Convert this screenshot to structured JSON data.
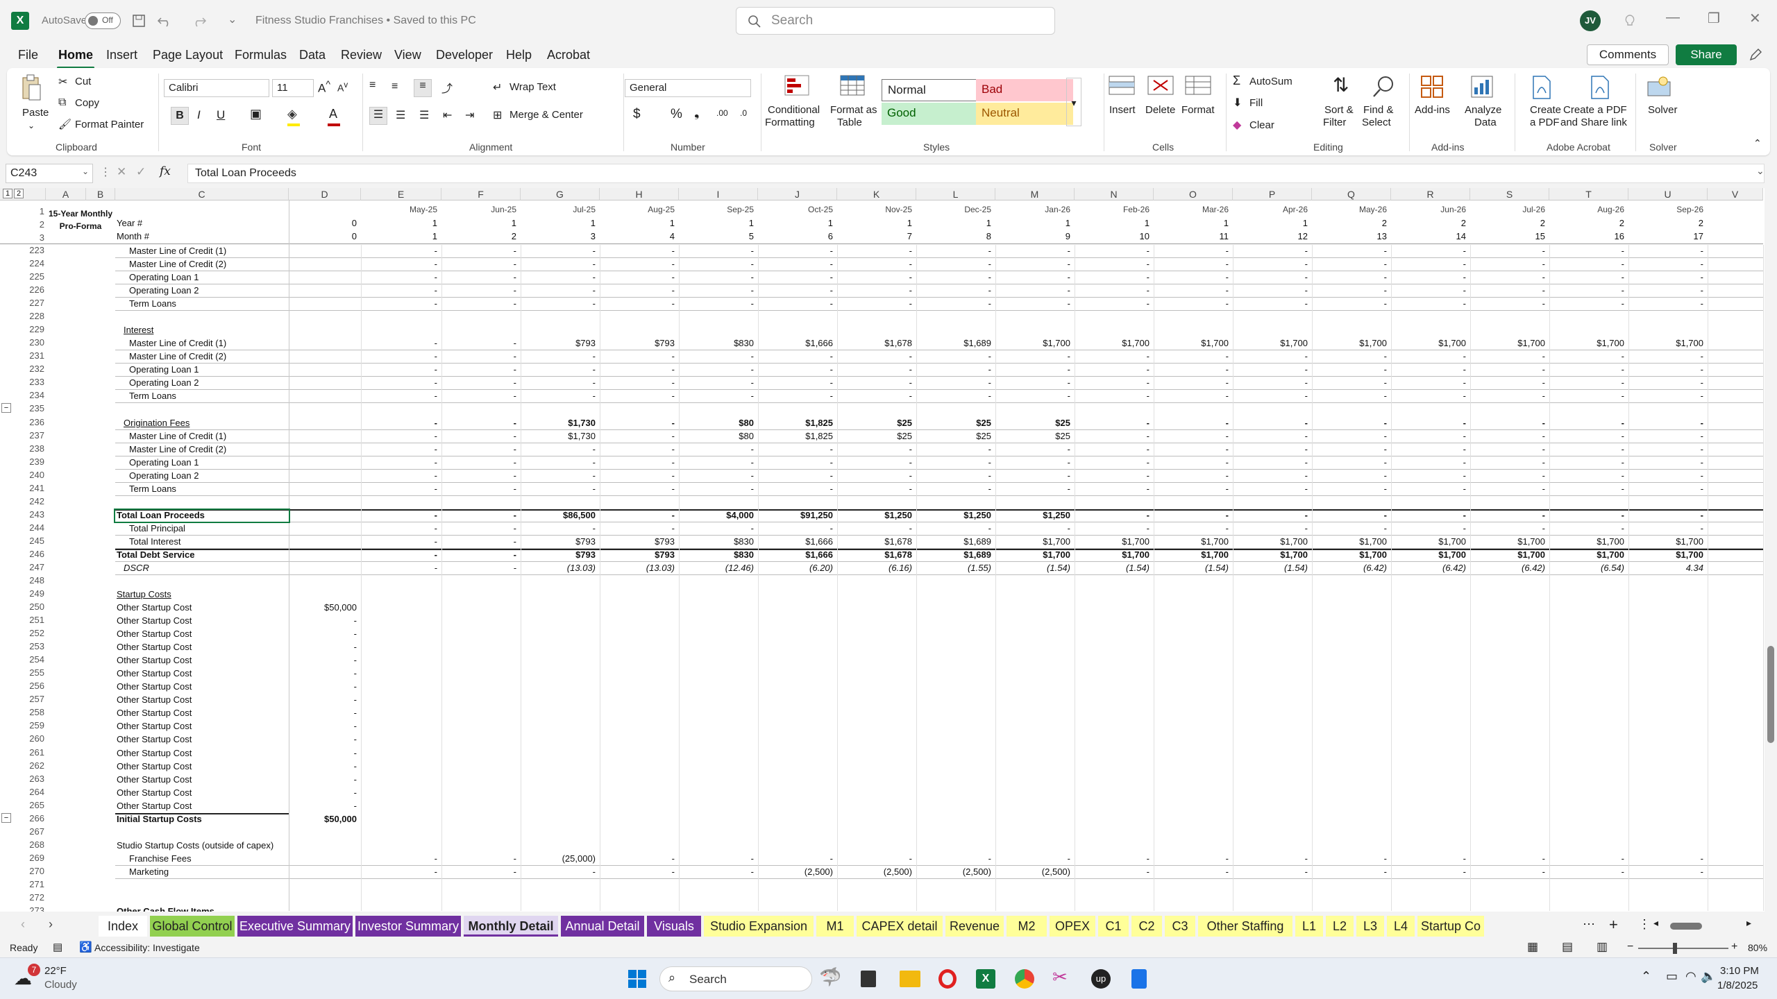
{
  "app": {
    "autosave_label": "AutoSave",
    "autosave_state": "Off",
    "doc_title": "Fitness Studio Franchises • Saved to this PC",
    "search_placeholder": "Search",
    "user_initials": "JV"
  },
  "menu": [
    "File",
    "Home",
    "Insert",
    "Page Layout",
    "Formulas",
    "Data",
    "Review",
    "View",
    "Developer",
    "Help",
    "Acrobat"
  ],
  "buttons": {
    "comments": "Comments",
    "share": "Share"
  },
  "ribbon": {
    "clipboard": {
      "paste": "Paste",
      "cut": "Cut",
      "copy": "Copy",
      "format_painter": "Format Painter",
      "label": "Clipboard"
    },
    "font": {
      "name": "Calibri",
      "size": "11",
      "label": "Font"
    },
    "alignment": {
      "wrap": "Wrap Text",
      "merge": "Merge & Center",
      "label": "Alignment"
    },
    "number": {
      "format": "General",
      "label": "Number"
    },
    "styles": {
      "cond": "Conditional",
      "cond2": "Formatting",
      "fmt_table": "Format as",
      "fmt_table2": "Table",
      "normal": "Normal",
      "bad": "Bad",
      "good": "Good",
      "neutral": "Neutral",
      "label": "Styles"
    },
    "cells": {
      "insert": "Insert",
      "delete": "Delete",
      "format": "Format",
      "label": "Cells"
    },
    "editing": {
      "autosum": "AutoSum",
      "fill": "Fill",
      "clear": "Clear",
      "sort": "Sort &",
      "sort2": "Filter",
      "find": "Find &",
      "find2": "Select",
      "label": "Editing"
    },
    "addins": {
      "addins": "Add-ins",
      "analyze": "Analyze",
      "analyze2": "Data",
      "label": "Add-ins"
    },
    "acrobat": {
      "create_pdf": "Create",
      "create_pdf2": "a PDF",
      "share_link": "Create a PDF",
      "share_link2": "and Share link",
      "label": "Adobe Acrobat"
    },
    "solver": {
      "solver": "Solver",
      "label": "Solver"
    },
    "colors": {
      "bad_bg": "#ffc7ce",
      "bad_fg": "#9c0006",
      "good_bg": "#c6efce",
      "good_fg": "#006100",
      "neutral_bg": "#ffeb9c",
      "neutral_fg": "#9c5700"
    }
  },
  "formula_bar": {
    "name_box": "C243",
    "formula": "Total Loan Proceeds"
  },
  "columns": [
    "A",
    "B",
    "C",
    "D",
    "E",
    "F",
    "G",
    "H",
    "I",
    "J",
    "K",
    "L",
    "M",
    "N",
    "O",
    "P",
    "Q",
    "R",
    "S",
    "T",
    "U",
    "V"
  ],
  "outline_levels": [
    "1",
    "2"
  ],
  "frozen": {
    "title": [
      "15-Year Monthly",
      "Pro-Forma"
    ],
    "year_label": "Year #",
    "month_label": "Month #",
    "dates": [
      "May-25",
      "Jun-25",
      "Jul-25",
      "Aug-25",
      "Sep-25",
      "Oct-25",
      "Nov-25",
      "Dec-25",
      "Jan-26",
      "Feb-26",
      "Mar-26",
      "Apr-26",
      "May-26",
      "Jun-26",
      "Jul-26",
      "Aug-26",
      "Sep-26"
    ],
    "years": [
      "0",
      "1",
      "1",
      "1",
      "1",
      "1",
      "1",
      "1",
      "1",
      "1",
      "1",
      "1",
      "1",
      "2",
      "2",
      "2",
      "2",
      "2"
    ],
    "months": [
      "0",
      "1",
      "2",
      "3",
      "4",
      "5",
      "6",
      "7",
      "8",
      "9",
      "10",
      "11",
      "12",
      "13",
      "14",
      "15",
      "16",
      "17"
    ]
  },
  "rows": [
    {
      "n": "223",
      "label": "Master Line of Credit (1)",
      "indent": 1,
      "vals": "dash"
    },
    {
      "n": "224",
      "label": "Master Line of Credit (2)",
      "indent": 1,
      "vals": "dash"
    },
    {
      "n": "225",
      "label": "Operating Loan 1",
      "indent": 1,
      "vals": "dash"
    },
    {
      "n": "226",
      "label": "Operating Loan 2",
      "indent": 1,
      "vals": "dash"
    },
    {
      "n": "227",
      "label": "Term Loans",
      "indent": 1,
      "vals": "dash"
    },
    {
      "n": "228",
      "label": ""
    },
    {
      "n": "229",
      "label": "Interest",
      "indent": 2,
      "underline": true
    },
    {
      "n": "230",
      "label": "Master Line of Credit (1)",
      "indent": 1,
      "vals": [
        "-",
        "-",
        "$793",
        "$793",
        "$830",
        "$1,666",
        "$1,678",
        "$1,689",
        "$1,700",
        "$1,700",
        "$1,700",
        "$1,700",
        "$1,700",
        "$1,700",
        "$1,700",
        "$1,700",
        "$1,700"
      ]
    },
    {
      "n": "231",
      "label": "Master Line of Credit (2)",
      "indent": 1,
      "vals": "dash"
    },
    {
      "n": "232",
      "label": "Operating Loan 1",
      "indent": 1,
      "vals": "dash"
    },
    {
      "n": "233",
      "label": "Operating Loan 2",
      "indent": 1,
      "vals": "dash"
    },
    {
      "n": "234",
      "label": "Term Loans",
      "indent": 1,
      "vals": "dash"
    },
    {
      "n": "235",
      "label": ""
    },
    {
      "n": "236",
      "label": "Origination Fees",
      "indent": 2,
      "underline": true,
      "bold_vals": true,
      "vals": [
        "-",
        "-",
        "$1,730",
        "-",
        "$80",
        "$1,825",
        "$25",
        "$25",
        "$25",
        "-",
        "-",
        "-",
        "-",
        "-",
        "-",
        "-",
        "-"
      ]
    },
    {
      "n": "237",
      "label": "Master Line of Credit (1)",
      "indent": 1,
      "vals": [
        "-",
        "-",
        "$1,730",
        "-",
        "$80",
        "$1,825",
        "$25",
        "$25",
        "$25",
        "-",
        "-",
        "-",
        "-",
        "-",
        "-",
        "-",
        "-"
      ]
    },
    {
      "n": "238",
      "label": "Master Line of Credit (2)",
      "indent": 1,
      "vals": "dash"
    },
    {
      "n": "239",
      "label": "Operating Loan 1",
      "indent": 1,
      "vals": "dash"
    },
    {
      "n": "240",
      "label": "Operating Loan 2",
      "indent": 1,
      "vals": "dash"
    },
    {
      "n": "241",
      "label": "Term Loans",
      "indent": 1,
      "vals": "dash"
    },
    {
      "n": "242",
      "label": ""
    },
    {
      "n": "243",
      "label": "Total Loan Proceeds",
      "bold": true,
      "bold_vals": true,
      "vals": [
        "-",
        "-",
        "$86,500",
        "-",
        "$4,000",
        "$91,250",
        "$1,250",
        "$1,250",
        "$1,250",
        "-",
        "-",
        "-",
        "-",
        "-",
        "-",
        "-",
        "-"
      ]
    },
    {
      "n": "244",
      "label": "Total Principal",
      "indent": 1,
      "vals": "dash"
    },
    {
      "n": "245",
      "label": "Total Interest",
      "indent": 1,
      "vals": [
        "-",
        "-",
        "$793",
        "$793",
        "$830",
        "$1,666",
        "$1,678",
        "$1,689",
        "$1,700",
        "$1,700",
        "$1,700",
        "$1,700",
        "$1,700",
        "$1,700",
        "$1,700",
        "$1,700",
        "$1,700"
      ]
    },
    {
      "n": "246",
      "label": "Total Debt Service",
      "bold": true,
      "bold_vals": true,
      "vals": [
        "-",
        "-",
        "$793",
        "$793",
        "$830",
        "$1,666",
        "$1,678",
        "$1,689",
        "$1,700",
        "$1,700",
        "$1,700",
        "$1,700",
        "$1,700",
        "$1,700",
        "$1,700",
        "$1,700",
        "$1,700"
      ]
    },
    {
      "n": "247",
      "label": "DSCR",
      "italic": true,
      "indent": 2,
      "vals": [
        "-",
        "-",
        "(13.03)",
        "(13.03)",
        "(12.46)",
        "(6.20)",
        "(6.16)",
        "(1.55)",
        "(1.54)",
        "(1.54)",
        "(1.54)",
        "(1.54)",
        "(6.42)",
        "(6.42)",
        "(6.42)",
        "(6.54)",
        "4.34"
      ]
    },
    {
      "n": "248",
      "label": ""
    },
    {
      "n": "249",
      "label": "Startup Costs",
      "underline": true
    },
    {
      "n": "250",
      "label": "Other Startup Cost",
      "d": "$50,000"
    },
    {
      "n": "251",
      "label": "Other Startup Cost",
      "d": "-"
    },
    {
      "n": "252",
      "label": "Other Startup Cost",
      "d": "-"
    },
    {
      "n": "253",
      "label": "Other Startup Cost",
      "d": "-"
    },
    {
      "n": "254",
      "label": "Other Startup Cost",
      "d": "-"
    },
    {
      "n": "255",
      "label": "Other Startup Cost",
      "d": "-"
    },
    {
      "n": "256",
      "label": "Other Startup Cost",
      "d": "-"
    },
    {
      "n": "257",
      "label": "Other Startup Cost",
      "d": "-"
    },
    {
      "n": "258",
      "label": "Other Startup Cost",
      "d": "-"
    },
    {
      "n": "259",
      "label": "Other Startup Cost",
      "d": "-"
    },
    {
      "n": "260",
      "label": "Other Startup Cost",
      "d": "-"
    },
    {
      "n": "261",
      "label": "Other Startup Cost",
      "d": "-"
    },
    {
      "n": "262",
      "label": "Other Startup Cost",
      "d": "-"
    },
    {
      "n": "263",
      "label": "Other Startup Cost",
      "d": "-"
    },
    {
      "n": "264",
      "label": "Other Startup Cost",
      "d": "-"
    },
    {
      "n": "265",
      "label": "Other Startup Cost",
      "d": "-"
    },
    {
      "n": "266",
      "label": "Initial Startup Costs",
      "bold": true,
      "d": "$50,000",
      "dbold": true
    },
    {
      "n": "267",
      "label": ""
    },
    {
      "n": "268",
      "label": "Studio Startup Costs (outside of capex)"
    },
    {
      "n": "269",
      "label": "Franchise Fees",
      "indent": 1,
      "vals": [
        "-",
        "-",
        "(25,000)",
        "-",
        "-",
        "-",
        "-",
        "-",
        "-",
        "-",
        "-",
        "-",
        "-",
        "-",
        "-",
        "-",
        "-"
      ]
    },
    {
      "n": "270",
      "label": "Marketing",
      "indent": 1,
      "vals": [
        "-",
        "-",
        "-",
        "-",
        "-",
        "(2,500)",
        "(2,500)",
        "(2,500)",
        "(2,500)",
        "-",
        "-",
        "-",
        "-",
        "-",
        "-",
        "-",
        "-"
      ]
    },
    {
      "n": "271",
      "label": ""
    },
    {
      "n": "272",
      "label": ""
    },
    {
      "n": "273",
      "label": "Other Cash Flow Items",
      "bold": true
    }
  ],
  "sheet_tabs": [
    {
      "label": "Index",
      "color": "#ffffff",
      "fg": "#222"
    },
    {
      "label": "Global Control",
      "color": "#92d050",
      "fg": "#222"
    },
    {
      "label": "Executive Summary",
      "color": "#7030a0",
      "fg": "#ffffff"
    },
    {
      "label": "Investor Summary",
      "color": "#7030a0",
      "fg": "#ffffff"
    },
    {
      "label": "Monthly Detail",
      "color": "#e0d6f0",
      "fg": "#222",
      "active": true
    },
    {
      "label": "Annual Detail",
      "color": "#7030a0",
      "fg": "#ffffff"
    },
    {
      "label": "Visuals",
      "color": "#7030a0",
      "fg": "#ffffff"
    },
    {
      "label": "Studio Expansion",
      "color": "#ffff99",
      "fg": "#222"
    },
    {
      "label": "M1",
      "color": "#ffff99",
      "fg": "#222"
    },
    {
      "label": "CAPEX detail",
      "color": "#ffff99",
      "fg": "#222"
    },
    {
      "label": "Revenue",
      "color": "#ffff99",
      "fg": "#222"
    },
    {
      "label": "M2",
      "color": "#ffff99",
      "fg": "#222"
    },
    {
      "label": "OPEX",
      "color": "#ffff99",
      "fg": "#222"
    },
    {
      "label": "C1",
      "color": "#ffff99",
      "fg": "#222"
    },
    {
      "label": "C2",
      "color": "#ffff99",
      "fg": "#222"
    },
    {
      "label": "C3",
      "color": "#ffff99",
      "fg": "#222"
    },
    {
      "label": "Other Staffing",
      "color": "#ffff99",
      "fg": "#222"
    },
    {
      "label": "L1",
      "color": "#ffff99",
      "fg": "#222"
    },
    {
      "label": "L2",
      "color": "#ffff99",
      "fg": "#222"
    },
    {
      "label": "L3",
      "color": "#ffff99",
      "fg": "#222"
    },
    {
      "label": "L4",
      "color": "#ffff99",
      "fg": "#222"
    },
    {
      "label": "Startup Co",
      "color": "#ffff99",
      "fg": "#222"
    }
  ],
  "status": {
    "ready": "Ready",
    "accessibility": "Accessibility: Investigate",
    "zoom": "80%"
  },
  "taskbar": {
    "temp": "22°F",
    "weather": "Cloudy",
    "badge": "7",
    "search": "Search",
    "time": "3:10 PM",
    "date": "1/8/2025"
  }
}
